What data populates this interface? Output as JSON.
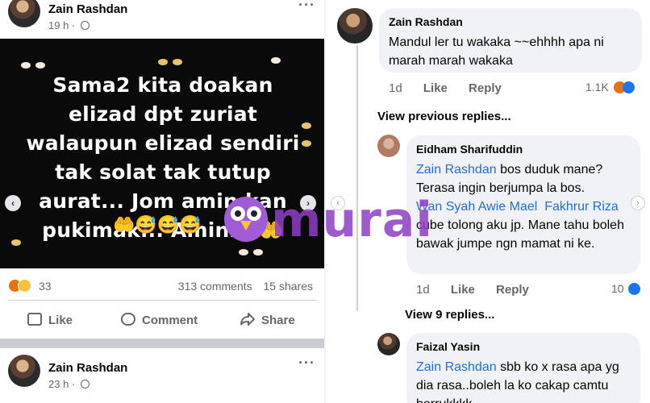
{
  "post1": {
    "author": "Zain Rashdan",
    "time": "19 h ·",
    "more": "···",
    "image_text": "Sama2 kita doakan elizad dpt zuriat walaupun elizad sendiri tak solat tak tutup aurat... Jom amin kan pukimak... Aminnn",
    "image_emoji_inline": "🤲",
    "image_emoji_row": "🤲😅😅😅",
    "reaction_count": "33",
    "comments": "313 comments",
    "shares": "15 shares",
    "actions": {
      "like": "Like",
      "comment": "Comment",
      "share": "Share"
    }
  },
  "post2": {
    "author": "Zain Rashdan",
    "time": "23 h ·",
    "more": "···"
  },
  "comments": {
    "c1": {
      "author": "Zain Rashdan",
      "text": "Mandul ler tu wakaka ~~ehhhh apa ni marah marah wakaka",
      "time": "1d",
      "like": "Like",
      "reply": "Reply",
      "reactions": "1.1K"
    },
    "view_previous": "View previous replies...",
    "c2": {
      "author": "Eidham Sharifuddin",
      "mention1": "Zain Rashdan",
      "text1": " bos duduk mane? Terasa ingin berjumpa la bos.",
      "mention2": "Wan Syah Awie Mael",
      "mention3": "Fakhrur Riza",
      "text2": " cube tolong aku jp. Mane tahu boleh bawak jumpe ngn mamat ni ke.",
      "time": "1d",
      "like": "Like",
      "reply": "Reply",
      "reactions": "10"
    },
    "view_more": "View 9 replies...",
    "c3": {
      "author": "Faizal Yasin",
      "mention1": "Zain Rashdan",
      "text1": " sbb ko x rasa apa yg dia rasa..boleh la ko cakap camtu berrukkkk"
    }
  },
  "watermark": {
    "text": "murai"
  },
  "colors": {
    "mention": "#216fdb",
    "watermark": "#8e3fc6",
    "like_blue": "#1877f2"
  }
}
